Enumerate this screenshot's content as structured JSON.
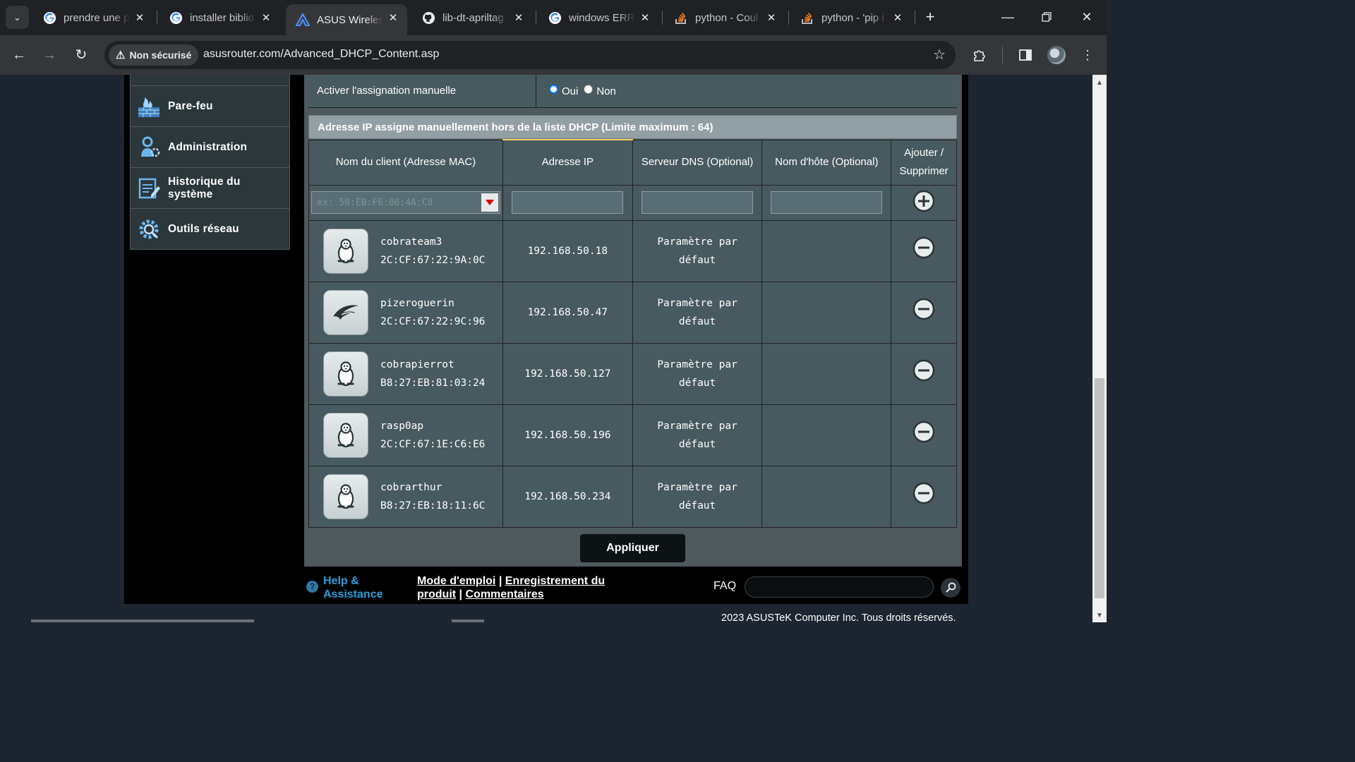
{
  "browser": {
    "tabs": [
      {
        "title": "prendre une p",
        "favicon": "google-icon",
        "active": false
      },
      {
        "title": "installer biblio",
        "favicon": "google-icon",
        "active": false
      },
      {
        "title": "ASUS Wireless",
        "favicon": "asus-icon",
        "active": true
      },
      {
        "title": "lib-dt-apriltag",
        "favicon": "github-icon",
        "active": false
      },
      {
        "title": "windows ERRO",
        "favicon": "google-icon",
        "active": false
      },
      {
        "title": "python - Coul",
        "favicon": "stackoverflow-icon",
        "active": false
      },
      {
        "title": "python - 'pip i",
        "favicon": "stackoverflow-icon",
        "active": false
      }
    ],
    "security_label": "Non sécurisé",
    "url": "asusrouter.com/Advanced_DHCP_Content.asp"
  },
  "sidebar": {
    "items": [
      {
        "label": "Pare-feu",
        "icon": "firewall-icon"
      },
      {
        "label": "Administration",
        "icon": "administration-icon"
      },
      {
        "label": "Historique du système",
        "icon": "system-log-icon"
      },
      {
        "label": "Outils réseau",
        "icon": "network-tools-icon"
      }
    ]
  },
  "manual_assignment": {
    "label": "Activer l'assignation manuelle",
    "option_yes": "Oui",
    "option_no": "Non",
    "selected": "Oui"
  },
  "table": {
    "title": "Adresse IP assigne manuellement hors de la liste DHCP (Limite maximum : 64)",
    "headers": {
      "client": "Nom du client (Adresse MAC)",
      "ip": "Adresse IP",
      "dns": "Serveur DNS (Optional)",
      "hostname": "Nom d'hôte (Optional)",
      "action_line1": "Ajouter /",
      "action_line2": "Supprimer"
    },
    "mac_placeholder": "ex: 50:EB:F6:86:4A:C8",
    "rows": [
      {
        "name": "cobrateam3",
        "mac": "2C:CF:67:22:9A:0C",
        "ip": "192.168.50.18",
        "dns_line1": "Paramètre par",
        "dns_line2": "défaut",
        "hostname": "",
        "icon": "linux-penguin-icon"
      },
      {
        "name": "pizeroguerin",
        "mac": "2C:CF:67:22:9C:96",
        "ip": "192.168.50.47",
        "dns_line1": "Paramètre par",
        "dns_line2": "défaut",
        "hostname": "",
        "icon": "rog-logo-icon"
      },
      {
        "name": "cobrapierrot",
        "mac": "B8:27:EB:81:03:24",
        "ip": "192.168.50.127",
        "dns_line1": "Paramètre par",
        "dns_line2": "défaut",
        "hostname": "",
        "icon": "linux-penguin-icon"
      },
      {
        "name": "rasp0ap",
        "mac": "2C:CF:67:1E:C6:E6",
        "ip": "192.168.50.196",
        "dns_line1": "Paramètre par",
        "dns_line2": "défaut",
        "hostname": "",
        "icon": "linux-penguin-icon"
      },
      {
        "name": "cobrarthur",
        "mac": "B8:27:EB:18:11:6C",
        "ip": "192.168.50.234",
        "dns_line1": "Paramètre par",
        "dns_line2": "défaut",
        "hostname": "",
        "icon": "linux-penguin-icon"
      }
    ]
  },
  "apply_label": "Appliquer",
  "footer": {
    "help_label": "Help & Assistance",
    "link_manual": "Mode d'emploi",
    "link_registration": "Enregistrement du produit",
    "link_feedback": "Commentaires",
    "separator": "|",
    "faq_label": "FAQ",
    "copyright": "2023 ASUSTeK Computer Inc. Tous droits réservés."
  },
  "colors": {
    "panel": "#4d595d",
    "cell": "#475a5f",
    "table_title": "#92a0a5",
    "help_link": "#2ea1d9"
  }
}
